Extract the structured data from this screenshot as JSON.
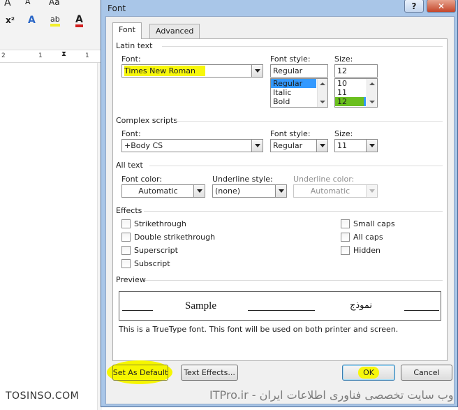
{
  "background": {
    "ribbon": {
      "font_grow": "A",
      "font_shrink": "A",
      "change_case": "Aa",
      "superscript": "x²",
      "text_effects": "A",
      "highlight": "ab",
      "font_color": "A"
    },
    "ruler": {
      "ticks": [
        "2",
        "1",
        "1"
      ]
    }
  },
  "dialog": {
    "title": "Font",
    "help_label": "?",
    "close_label": "✕",
    "tabs": [
      {
        "label": "Font",
        "active": true
      },
      {
        "label": "Advanced",
        "active": false
      }
    ],
    "latin": {
      "section": "Latin text",
      "font_label": "Font:",
      "font_value": "Times New Roman",
      "style_label": "Font style:",
      "style_value": "Regular",
      "style_options": [
        "Regular",
        "Italic",
        "Bold"
      ],
      "size_label": "Size:",
      "size_value": "12",
      "size_options": [
        "10",
        "11",
        "12"
      ]
    },
    "complex": {
      "section": "Complex scripts",
      "font_label": "Font:",
      "font_value": "+Body CS",
      "style_label": "Font style:",
      "style_value": "Regular",
      "size_label": "Size:",
      "size_value": "11"
    },
    "all_text": {
      "section": "All text",
      "color_label": "Font color:",
      "color_value": "Automatic",
      "underline_label": "Underline style:",
      "underline_value": "(none)",
      "ucolor_label": "Underline color:",
      "ucolor_value": "Automatic"
    },
    "effects": {
      "section": "Effects",
      "left": [
        "Strikethrough",
        "Double strikethrough",
        "Superscript",
        "Subscript"
      ],
      "right": [
        "Small caps",
        "All caps",
        "Hidden"
      ]
    },
    "preview": {
      "section": "Preview",
      "sample": "Sample",
      "arabic": "نموذج",
      "note": "This is a TrueType font. This font will be used on both printer and screen."
    },
    "buttons": {
      "set_default": "Set As Default",
      "text_effects": "Text Effects...",
      "ok": "OK",
      "cancel": "Cancel"
    }
  },
  "watermark": {
    "left": "TOSINSO.COM",
    "right": "ITPro.ir - وب سایت تخصصی فناوری اطلاعات ایران"
  },
  "colors": {
    "title_frame": "#a9c6e8",
    "selection": "#3399ff",
    "highlight_yellow": "#f7f70a",
    "highlight_green": "#6abf1e"
  }
}
